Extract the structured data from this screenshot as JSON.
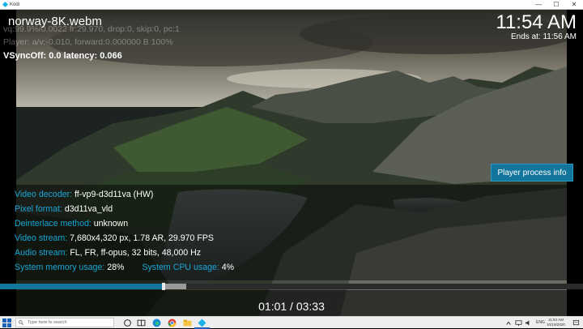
{
  "window": {
    "title": "Kodi",
    "minimize": "—",
    "maximize": "☐",
    "close": "✕"
  },
  "player": {
    "title": "norway-8K.webm",
    "debug_line1": "vq:99.9%/0.0022   fr:29.970, drop:0, skip:0, pc:1",
    "debug_line2": "Player: a/v:-0.010, forward:0.000000 B 100%",
    "debug_line3": "VSyncOff: 0.0 latency: 0.066",
    "clock": "11:54 AM",
    "ends_at": "Ends at: 11:56 AM",
    "player_process_info": "Player process info",
    "progress": 0.28,
    "elapsed_display": "01:01 / 03:33"
  },
  "info": {
    "video_decoder_label": "Video decoder:",
    "video_decoder_value": "ff-vp9-d3d11va (HW)",
    "pixel_format_label": "Pixel format:",
    "pixel_format_value": "d3d11va_vld",
    "deinterlace_label": "Deinterlace method:",
    "deinterlace_value": "unknown",
    "video_stream_label": "Video stream:",
    "video_stream_value": "7,680x4,320 px, 1.78 AR, 29.970 FPS",
    "audio_stream_label": "Audio stream:",
    "audio_stream_value": "FL, FR, ff-opus, 32 bits, 48,000 Hz",
    "mem_label": "System memory usage:",
    "mem_value": "28%",
    "cpu_label": "System CPU usage:",
    "cpu_value": "4%"
  },
  "taskbar": {
    "search_placeholder": "Type here to search",
    "lang": "ENG",
    "time": "11:54 AM",
    "date": "10/19/2020"
  },
  "colors": {
    "accent": "#12759c",
    "label": "#1aa6d6"
  }
}
